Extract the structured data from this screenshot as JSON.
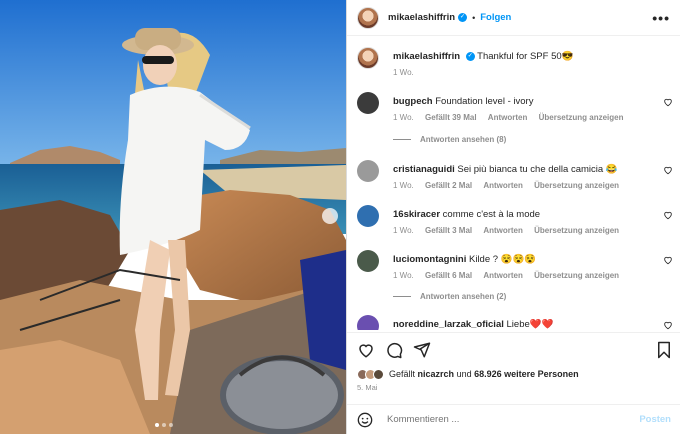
{
  "post": {
    "author": "mikaelashiffrin",
    "follow_label": "Folgen",
    "more_label": "•••",
    "caption": "Thankful for SPF 50😎",
    "caption_time": "1 Wo."
  },
  "comments": [
    {
      "user": "bugpech",
      "text": "Foundation level - ivory",
      "time": "1 Wo.",
      "likes": "Gefällt 39 Mal",
      "reply": "Antworten",
      "translate": "Übersetzung anzeigen",
      "avatar_color": "#3b3b3b"
    },
    {
      "user": "cristianaguidi",
      "text": "Sei più bianca tu che della camicia 😂",
      "time": "1 Wo.",
      "likes": "Gefällt 2 Mal",
      "reply": "Antworten",
      "translate": "Übersetzung anzeigen",
      "avatar_color": "#9a9a9a"
    },
    {
      "user": "16skiracer",
      "text": "comme c'est à la mode",
      "time": "1 Wo.",
      "likes": "Gefällt 3 Mal",
      "reply": "Antworten",
      "translate": "Übersetzung anzeigen",
      "avatar_color": "#2f6fb0"
    },
    {
      "user": "luciomontagnini",
      "text": "Kilde ? 😵😵😵",
      "time": "1 Wo.",
      "likes": "Gefällt 6 Mal",
      "reply": "Antworten",
      "translate": "Übersetzung anzeigen",
      "avatar_color": "#4a5a4a"
    },
    {
      "user": "noreddine_larzak_oficial",
      "text": "Liebe❤️❤️",
      "time": "",
      "likes": "",
      "reply": "",
      "translate": "",
      "avatar_color": "#6a4fb0"
    }
  ],
  "reply_threads": [
    {
      "label": "Antworten ansehen (8)"
    },
    {
      "label": "Antworten ansehen (2)"
    }
  ],
  "likes": {
    "prefix": "Gefällt",
    "user": "nicazrch",
    "middle": "und",
    "count": "68.926 weitere Personen"
  },
  "date": "5. Mai",
  "comment_input": {
    "placeholder": "Kommentieren ..."
  },
  "post_button": "Posten",
  "icons": [
    "heart-icon",
    "comment-icon",
    "share-icon",
    "bookmark-icon",
    "smiley-icon",
    "verified-icon"
  ],
  "colors": {
    "accent": "#0095f6",
    "muted": "#8e8e8e",
    "post_disabled": "#b2dffc"
  }
}
